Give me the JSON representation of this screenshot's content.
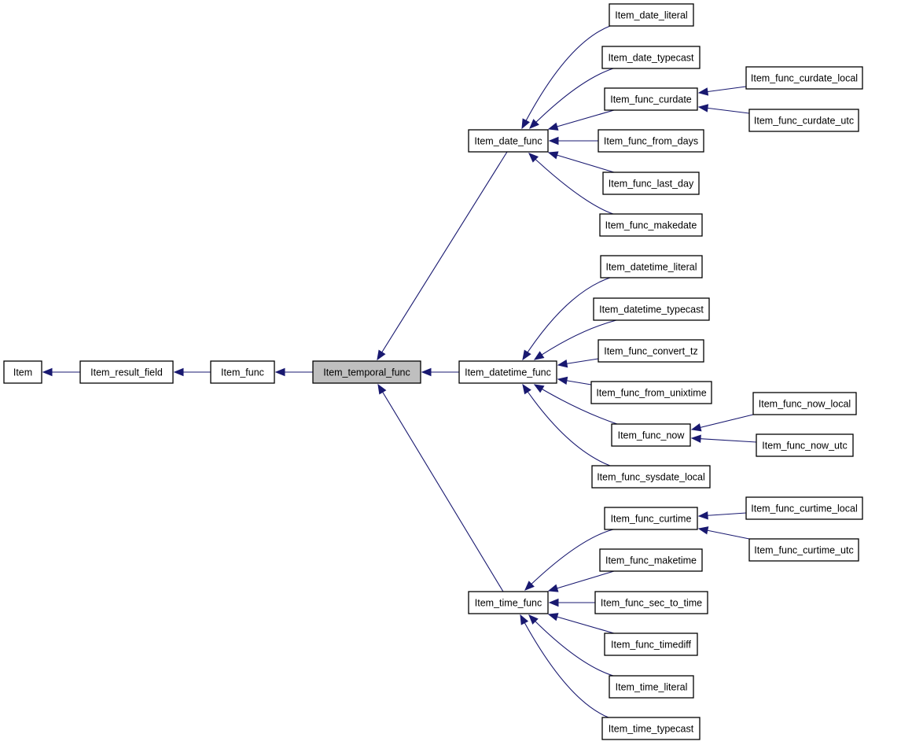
{
  "diagram": {
    "type": "class-inheritance-graph",
    "colors": {
      "edge": "#191970",
      "node_border": "#000000",
      "node_fill": "#ffffff",
      "highlight_fill": "#bfbfbf"
    },
    "nodes": [
      {
        "id": "item",
        "label": "Item"
      },
      {
        "id": "item_result_field",
        "label": "Item_result_field"
      },
      {
        "id": "item_func",
        "label": "Item_func"
      },
      {
        "id": "item_temporal_func",
        "label": "Item_temporal_func",
        "highlighted": true
      },
      {
        "id": "item_date_func",
        "label": "Item_date_func"
      },
      {
        "id": "item_datetime_func",
        "label": "Item_datetime_func"
      },
      {
        "id": "item_time_func",
        "label": "Item_time_func"
      },
      {
        "id": "item_date_literal",
        "label": "Item_date_literal"
      },
      {
        "id": "item_date_typecast",
        "label": "Item_date_typecast"
      },
      {
        "id": "item_func_curdate",
        "label": "Item_func_curdate"
      },
      {
        "id": "item_func_from_days",
        "label": "Item_func_from_days"
      },
      {
        "id": "item_func_last_day",
        "label": "Item_func_last_day"
      },
      {
        "id": "item_func_makedate",
        "label": "Item_func_makedate"
      },
      {
        "id": "item_func_curdate_local",
        "label": "Item_func_curdate_local"
      },
      {
        "id": "item_func_curdate_utc",
        "label": "Item_func_curdate_utc"
      },
      {
        "id": "item_datetime_literal",
        "label": "Item_datetime_literal"
      },
      {
        "id": "item_datetime_typecast",
        "label": "Item_datetime_typecast"
      },
      {
        "id": "item_func_convert_tz",
        "label": "Item_func_convert_tz"
      },
      {
        "id": "item_func_from_unixtime",
        "label": "Item_func_from_unixtime"
      },
      {
        "id": "item_func_now",
        "label": "Item_func_now"
      },
      {
        "id": "item_func_sysdate_local",
        "label": "Item_func_sysdate_local"
      },
      {
        "id": "item_func_now_local",
        "label": "Item_func_now_local"
      },
      {
        "id": "item_func_now_utc",
        "label": "Item_func_now_utc"
      },
      {
        "id": "item_func_curtime",
        "label": "Item_func_curtime"
      },
      {
        "id": "item_func_maketime",
        "label": "Item_func_maketime"
      },
      {
        "id": "item_func_sec_to_time",
        "label": "Item_func_sec_to_time"
      },
      {
        "id": "item_func_timediff",
        "label": "Item_func_timediff"
      },
      {
        "id": "item_time_literal",
        "label": "Item_time_literal"
      },
      {
        "id": "item_time_typecast",
        "label": "Item_time_typecast"
      },
      {
        "id": "item_func_curtime_local",
        "label": "Item_func_curtime_local"
      },
      {
        "id": "item_func_curtime_utc",
        "label": "Item_func_curtime_utc"
      }
    ],
    "edges": [
      {
        "from": "item_result_field",
        "to": "item"
      },
      {
        "from": "item_func",
        "to": "item_result_field"
      },
      {
        "from": "item_temporal_func",
        "to": "item_func"
      },
      {
        "from": "item_date_func",
        "to": "item_temporal_func"
      },
      {
        "from": "item_datetime_func",
        "to": "item_temporal_func"
      },
      {
        "from": "item_time_func",
        "to": "item_temporal_func"
      },
      {
        "from": "item_date_literal",
        "to": "item_date_func"
      },
      {
        "from": "item_date_typecast",
        "to": "item_date_func"
      },
      {
        "from": "item_func_curdate",
        "to": "item_date_func"
      },
      {
        "from": "item_func_from_days",
        "to": "item_date_func"
      },
      {
        "from": "item_func_last_day",
        "to": "item_date_func"
      },
      {
        "from": "item_func_makedate",
        "to": "item_date_func"
      },
      {
        "from": "item_func_curdate_local",
        "to": "item_func_curdate"
      },
      {
        "from": "item_func_curdate_utc",
        "to": "item_func_curdate"
      },
      {
        "from": "item_datetime_literal",
        "to": "item_datetime_func"
      },
      {
        "from": "item_datetime_typecast",
        "to": "item_datetime_func"
      },
      {
        "from": "item_func_convert_tz",
        "to": "item_datetime_func"
      },
      {
        "from": "item_func_from_unixtime",
        "to": "item_datetime_func"
      },
      {
        "from": "item_func_now",
        "to": "item_datetime_func"
      },
      {
        "from": "item_func_sysdate_local",
        "to": "item_datetime_func"
      },
      {
        "from": "item_func_now_local",
        "to": "item_func_now"
      },
      {
        "from": "item_func_now_utc",
        "to": "item_func_now"
      },
      {
        "from": "item_func_curtime",
        "to": "item_time_func"
      },
      {
        "from": "item_func_maketime",
        "to": "item_time_func"
      },
      {
        "from": "item_func_sec_to_time",
        "to": "item_time_func"
      },
      {
        "from": "item_func_timediff",
        "to": "item_time_func"
      },
      {
        "from": "item_time_literal",
        "to": "item_time_func"
      },
      {
        "from": "item_time_typecast",
        "to": "item_time_func"
      },
      {
        "from": "item_func_curtime_local",
        "to": "item_func_curtime"
      },
      {
        "from": "item_func_curtime_utc",
        "to": "item_func_curtime"
      }
    ]
  }
}
